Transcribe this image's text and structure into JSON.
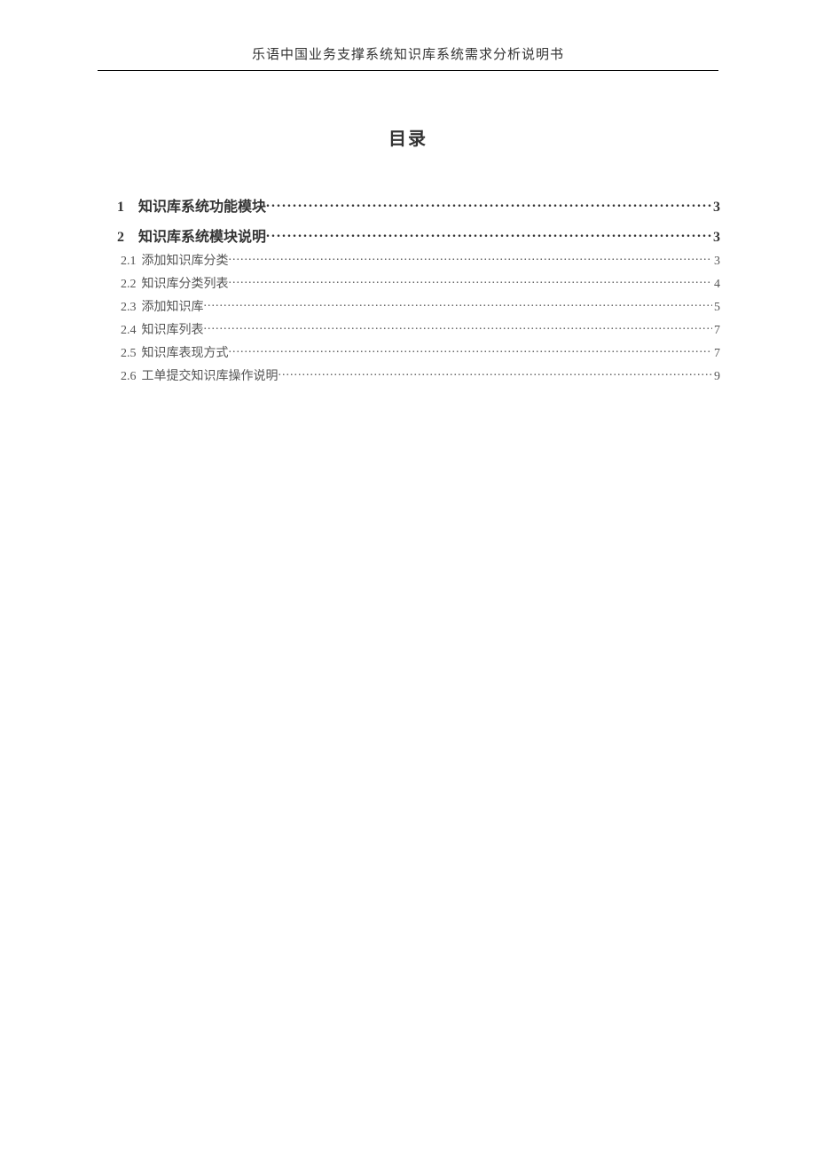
{
  "header": {
    "title": "乐语中国业务支撑系统知识库系统需求分析说明书"
  },
  "toc": {
    "heading": "目录",
    "entries": [
      {
        "level": 1,
        "num": "1",
        "label": "知识库系统功能模块",
        "page": "3"
      },
      {
        "level": 1,
        "num": "2",
        "label": "知识库系统模块说明",
        "page": "3"
      },
      {
        "level": 2,
        "num": "2.1",
        "label": "添加知识库分类",
        "page": "3"
      },
      {
        "level": 2,
        "num": "2.2",
        "label": "知识库分类列表",
        "page": "4"
      },
      {
        "level": 2,
        "num": "2.3",
        "label": "添加知识库",
        "page": "5"
      },
      {
        "level": 2,
        "num": "2.4",
        "label": "知识库列表",
        "page": "7"
      },
      {
        "level": 2,
        "num": "2.5",
        "label": "知识库表现方式",
        "page": "7"
      },
      {
        "level": 2,
        "num": "2.6",
        "label": "工单提交知识库操作说明",
        "page": "9"
      }
    ]
  }
}
